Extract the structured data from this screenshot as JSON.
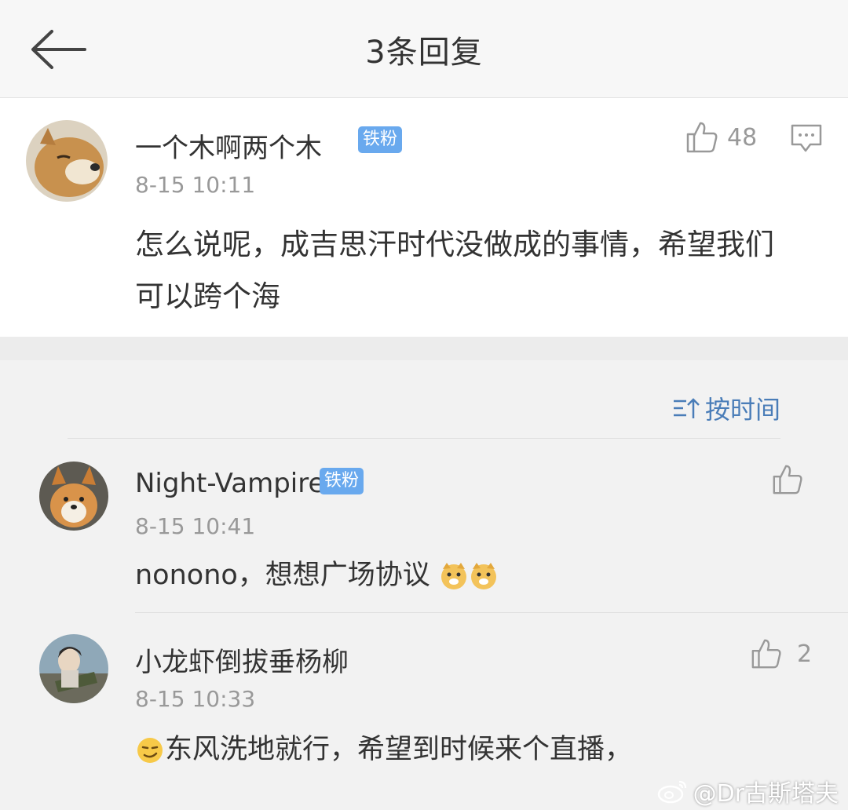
{
  "header": {
    "title": "3条回复"
  },
  "main_comment": {
    "username": "一个木啊两个木",
    "badge": "铁粉",
    "time": "8-15 10:11",
    "likes": "48",
    "text": "怎么说呢，成吉思汗时代没做成的事情，希望我们可以跨个海"
  },
  "sort": {
    "label": "按时间"
  },
  "replies": [
    {
      "username": "Night-Vampire",
      "badge": "铁粉",
      "time": "8-15 10:41",
      "likes": "",
      "text": "nonono，想想广场协议"
    },
    {
      "username": "小龙虾倒拔垂杨柳",
      "badge": "",
      "time": "8-15 10:33",
      "likes": "2",
      "text": "东风洗地就行，希望到时候来个直播，"
    }
  ],
  "watermark": "@Dr古斯塔夫",
  "colors": {
    "badge": "#69a9ee",
    "sort_link": "#4a7db8",
    "muted": "#999999",
    "text": "#333333"
  },
  "icons": [
    "back-arrow-icon",
    "thumbs-up-icon",
    "comment-icon",
    "sort-icon",
    "doge-emoji-icon",
    "smirk-emoji-icon",
    "weibo-logo-icon"
  ]
}
